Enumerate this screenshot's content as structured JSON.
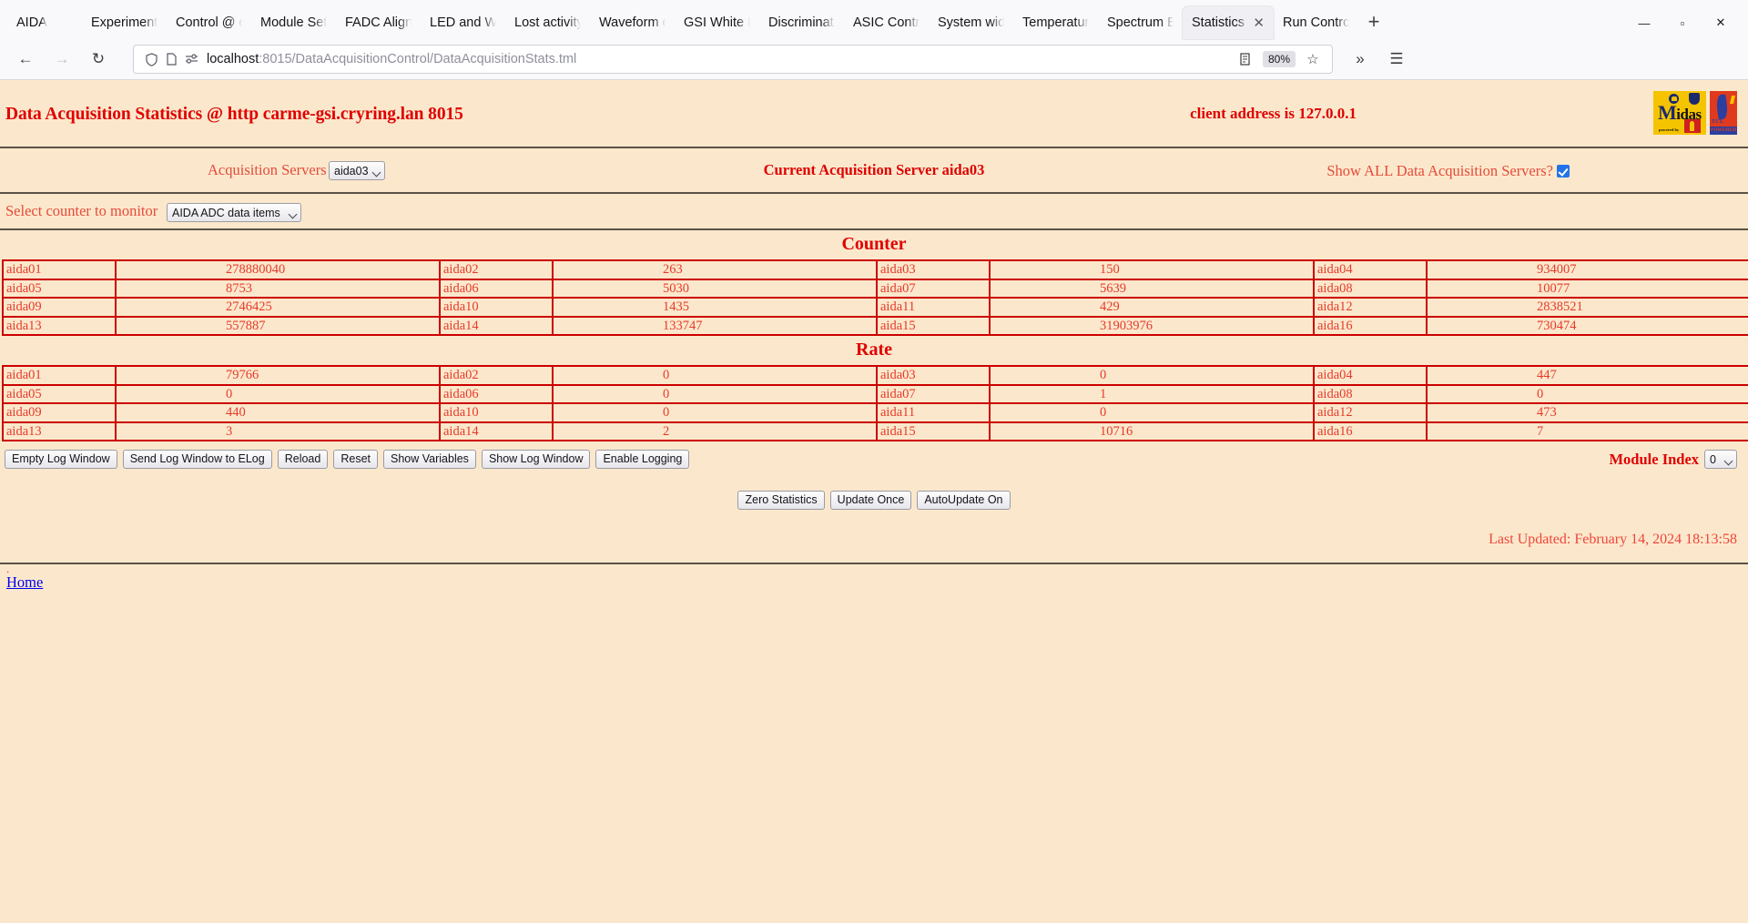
{
  "browser": {
    "tabs": [
      {
        "label": "AIDA",
        "active": false
      },
      {
        "label": "Experiment C",
        "active": false
      },
      {
        "label": "Control @ ca",
        "active": false
      },
      {
        "label": "Module Setti",
        "active": false
      },
      {
        "label": "FADC Align &",
        "active": false
      },
      {
        "label": "LED and Wav",
        "active": false
      },
      {
        "label": "Lost activity r",
        "active": false
      },
      {
        "label": "Waveform ca",
        "active": false
      },
      {
        "label": "GSI White Ra",
        "active": false
      },
      {
        "label": "Discriminator",
        "active": false
      },
      {
        "label": "ASIC Control",
        "active": false
      },
      {
        "label": "System wide",
        "active": false
      },
      {
        "label": "Temperature",
        "active": false
      },
      {
        "label": "Spectrum Bro",
        "active": false
      },
      {
        "label": "Statistics @",
        "active": true
      },
      {
        "label": "Run Control (",
        "active": false
      }
    ],
    "new_tab_label": "+",
    "window_controls": {
      "minimize": "—",
      "maximize": "▫",
      "close": "✕"
    },
    "nav": {
      "back": "←",
      "forward": "→",
      "reload": "↻",
      "shield_icon": "shield",
      "page_icon": "page",
      "permissions_icon": "permissions",
      "url_host": "localhost",
      "url_rest": ":8015/DataAcquisitionControl/DataAcquisitionStats.tml",
      "reader_label": "reader-view",
      "zoom_level": "80%",
      "bookmark_label": "☆",
      "overflow_label": "»",
      "menu_label": "☰"
    }
  },
  "page": {
    "title": "Data Acquisition Statistics @ http carme-gsi.cryring.lan 8015",
    "client_address": "client address is 127.0.0.1",
    "logos": {
      "midas_word": "idas",
      "midas_initial": "M",
      "midas_sub": "powered by",
      "tcl_name": "TCL",
      "tcl_powered": "POWERED"
    },
    "acquisition_servers_label": "Acquisition Servers",
    "acquisition_servers_value": "aida03",
    "current_server_text": "Current Acquisition Server aida03",
    "show_all_label": "Show ALL Data Acquisition Servers?",
    "show_all_checked": true,
    "counter_select_label": "Select counter to monitor",
    "counter_select_value": "AIDA ADC data items",
    "counter_heading": "Counter",
    "rate_heading": "Rate",
    "counter_rows": [
      [
        {
          "name": "aida01",
          "value": "278880040"
        },
        {
          "name": "aida02",
          "value": "263"
        },
        {
          "name": "aida03",
          "value": "150"
        },
        {
          "name": "aida04",
          "value": "934007"
        }
      ],
      [
        {
          "name": "aida05",
          "value": "8753"
        },
        {
          "name": "aida06",
          "value": "5030"
        },
        {
          "name": "aida07",
          "value": "5639"
        },
        {
          "name": "aida08",
          "value": "10077"
        }
      ],
      [
        {
          "name": "aida09",
          "value": "2746425"
        },
        {
          "name": "aida10",
          "value": "1435"
        },
        {
          "name": "aida11",
          "value": "429"
        },
        {
          "name": "aida12",
          "value": "2838521"
        }
      ],
      [
        {
          "name": "aida13",
          "value": "557887"
        },
        {
          "name": "aida14",
          "value": "133747"
        },
        {
          "name": "aida15",
          "value": "31903976"
        },
        {
          "name": "aida16",
          "value": "730474"
        }
      ]
    ],
    "rate_rows": [
      [
        {
          "name": "aida01",
          "value": "79766"
        },
        {
          "name": "aida02",
          "value": "0"
        },
        {
          "name": "aida03",
          "value": "0"
        },
        {
          "name": "aida04",
          "value": "447"
        }
      ],
      [
        {
          "name": "aida05",
          "value": "0"
        },
        {
          "name": "aida06",
          "value": "0"
        },
        {
          "name": "aida07",
          "value": "1"
        },
        {
          "name": "aida08",
          "value": "0"
        }
      ],
      [
        {
          "name": "aida09",
          "value": "440"
        },
        {
          "name": "aida10",
          "value": "0"
        },
        {
          "name": "aida11",
          "value": "0"
        },
        {
          "name": "aida12",
          "value": "473"
        }
      ],
      [
        {
          "name": "aida13",
          "value": "3"
        },
        {
          "name": "aida14",
          "value": "2"
        },
        {
          "name": "aida15",
          "value": "10716"
        },
        {
          "name": "aida16",
          "value": "7"
        }
      ]
    ],
    "log_buttons": [
      "Empty Log Window",
      "Send Log Window to ELog",
      "Reload",
      "Reset",
      "Show Variables",
      "Show Log Window",
      "Enable Logging"
    ],
    "module_index_label": "Module Index",
    "module_index_value": "0",
    "center_buttons": [
      "Zero Statistics",
      "Update Once",
      "AutoUpdate On"
    ],
    "last_updated": "Last Updated: February 14, 2024 18:13:58",
    "footer_dot": ".",
    "home_link": "Home",
    "colors": {
      "page_background": "#fbe8cc",
      "heading_red": "#e00000",
      "text_red": "#e8392b",
      "table_border": "#cc0000",
      "link_blue": "#0000ee",
      "rule_gray": "#5a5248"
    }
  }
}
